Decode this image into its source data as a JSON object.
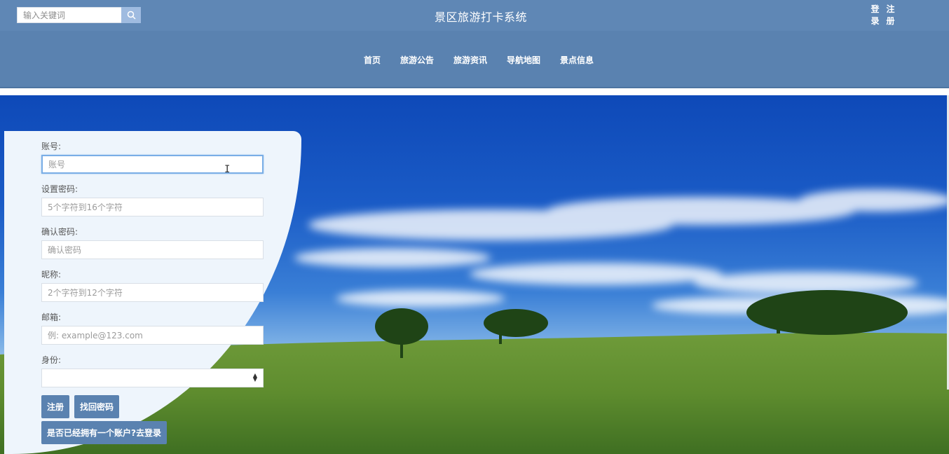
{
  "header": {
    "search_placeholder": "输入关键词",
    "site_title": "景区旅游打卡系统",
    "auth": [
      {
        "chars": [
          "登",
          "录"
        ]
      },
      {
        "chars": [
          "注",
          "册"
        ]
      }
    ]
  },
  "nav": {
    "items": [
      "首页",
      "旅游公告",
      "旅游资讯",
      "导航地图",
      "景点信息"
    ]
  },
  "form": {
    "account_label": "账号:",
    "account_placeholder": "账号",
    "password_label": "设置密码:",
    "password_placeholder": "5个字符到16个字符",
    "confirm_label": "确认密码:",
    "confirm_placeholder": "确认密码",
    "nickname_label": "昵称:",
    "nickname_placeholder": "2个字符到12个字符",
    "email_label": "邮箱:",
    "email_placeholder": "例: example@123.com",
    "identity_label": "身份:",
    "identity_value": "",
    "register_button": "注册",
    "recover_button": "找回密码",
    "login_link_button": "是否已经拥有一个账户?去登录"
  },
  "colors": {
    "header_bg": "#5f87b5",
    "button_bg": "#5a82b0",
    "panel_bg": "#eef5fc"
  }
}
